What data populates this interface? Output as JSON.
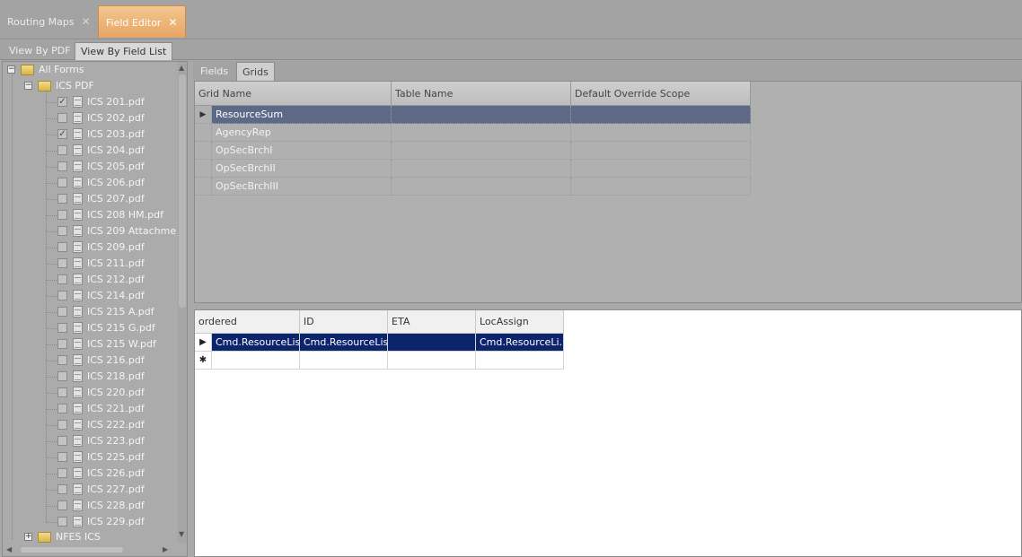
{
  "doc_tabs": [
    {
      "label": "Routing Maps",
      "close": "✕",
      "active": false
    },
    {
      "label": "Field Editor",
      "close": "✕",
      "active": true
    }
  ],
  "view_tabs": [
    {
      "label": "View By PDF",
      "active": false
    },
    {
      "label": "View By Field List",
      "active": true
    }
  ],
  "tree": {
    "root": {
      "label": "All Forms",
      "expander": "−"
    },
    "folder": {
      "label": "ICS PDF",
      "expander": "−"
    },
    "files": [
      {
        "label": "ICS 201.pdf",
        "checked": true
      },
      {
        "label": "ICS 202.pdf",
        "checked": false
      },
      {
        "label": "ICS 203.pdf",
        "checked": true
      },
      {
        "label": "ICS 204.pdf",
        "checked": false
      },
      {
        "label": "ICS 205.pdf",
        "checked": false
      },
      {
        "label": "ICS 206.pdf",
        "checked": false
      },
      {
        "label": "ICS 207.pdf",
        "checked": false
      },
      {
        "label": "ICS 208 HM.pdf",
        "checked": false
      },
      {
        "label": "ICS 209 Attachme",
        "checked": false
      },
      {
        "label": "ICS 209.pdf",
        "checked": false
      },
      {
        "label": "ICS 211.pdf",
        "checked": false
      },
      {
        "label": "ICS 212.pdf",
        "checked": false
      },
      {
        "label": "ICS 214.pdf",
        "checked": false
      },
      {
        "label": "ICS 215 A.pdf",
        "checked": false
      },
      {
        "label": "ICS 215 G.pdf",
        "checked": false
      },
      {
        "label": "ICS 215 W.pdf",
        "checked": false
      },
      {
        "label": "ICS 216.pdf",
        "checked": false
      },
      {
        "label": "ICS 218.pdf",
        "checked": false
      },
      {
        "label": "ICS 220.pdf",
        "checked": false
      },
      {
        "label": "ICS 221.pdf",
        "checked": false
      },
      {
        "label": "ICS 222.pdf",
        "checked": false
      },
      {
        "label": "ICS 223.pdf",
        "checked": false
      },
      {
        "label": "ICS 225.pdf",
        "checked": false
      },
      {
        "label": "ICS 226.pdf",
        "checked": false
      },
      {
        "label": "ICS 227.pdf",
        "checked": false
      },
      {
        "label": "ICS 228.pdf",
        "checked": false
      },
      {
        "label": "ICS 229.pdf",
        "checked": false
      }
    ],
    "folder2": {
      "label": "NFES ICS",
      "expander": "+"
    },
    "check_mark": "✓"
  },
  "inner_tabs": [
    {
      "label": "Fields",
      "active": false
    },
    {
      "label": "Grids",
      "active": true
    }
  ],
  "grids_table": {
    "columns": [
      "Grid Name",
      "Table Name",
      "Default Override Scope"
    ],
    "rows": [
      {
        "grid_name": "ResourceSum",
        "table_name": "",
        "scope": "",
        "selected": true
      },
      {
        "grid_name": "AgencyRep",
        "table_name": "",
        "scope": "",
        "selected": false
      },
      {
        "grid_name": "OpSecBrchI",
        "table_name": "",
        "scope": "",
        "selected": false
      },
      {
        "grid_name": "OpSecBrchII",
        "table_name": "",
        "scope": "",
        "selected": false
      },
      {
        "grid_name": "OpSecBrchIII",
        "table_name": "",
        "scope": "",
        "selected": false
      }
    ],
    "current_row_marker": "▶"
  },
  "detail_table": {
    "columns": [
      "ordered",
      "ID",
      "ETA",
      "LocAssign"
    ],
    "rows": [
      {
        "cells": [
          "Cmd.ResourceList",
          "Cmd.ResourceList",
          "",
          "Cmd.ResourceLi..."
        ],
        "marker": "▶",
        "selected": true
      },
      {
        "cells": [
          "",
          "",
          "",
          ""
        ],
        "marker": "✱",
        "selected": false
      }
    ]
  },
  "scroll_arrows": {
    "up": "▲",
    "down": "▼",
    "left": "◀",
    "right": "▶"
  }
}
